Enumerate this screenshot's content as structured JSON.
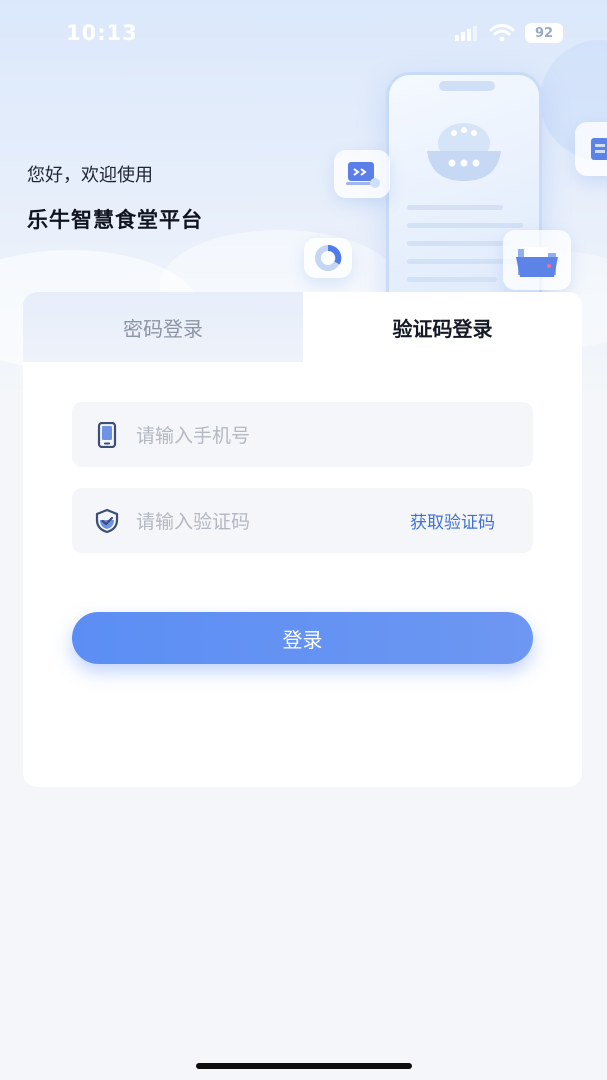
{
  "status_bar": {
    "time": "10:13",
    "battery": "92"
  },
  "header": {
    "greeting": "您好，欢迎使用",
    "platform_name": "乐牛智慧食堂平台"
  },
  "tabs": [
    {
      "label": "密码登录",
      "active": false
    },
    {
      "label": "验证码登录",
      "active": true
    }
  ],
  "form": {
    "phone_placeholder": "请输入手机号",
    "code_placeholder": "请输入验证码",
    "get_code_label": "获取验证码",
    "login_label": "登录"
  },
  "colors": {
    "accent": "#5b8ef4",
    "link": "#3f70d6",
    "icon": "#3c4e78"
  }
}
